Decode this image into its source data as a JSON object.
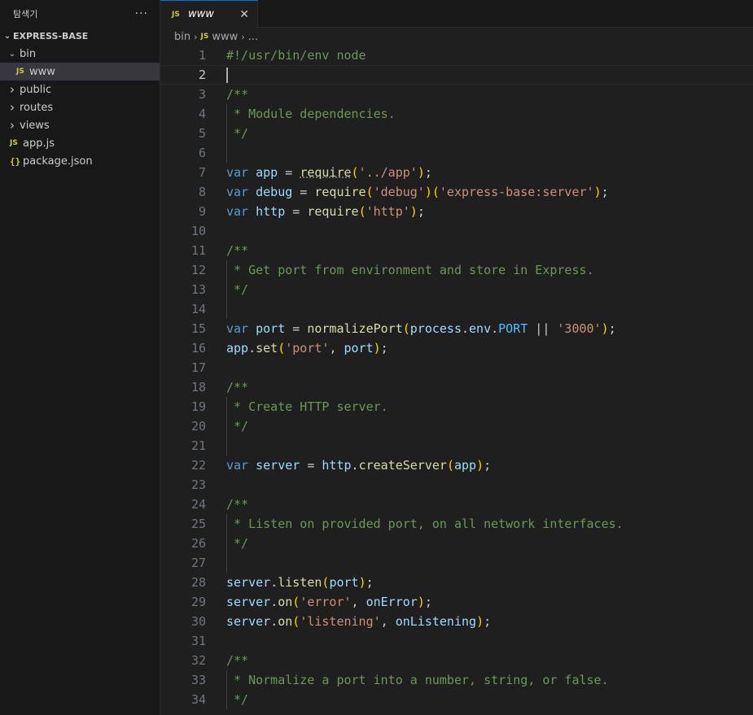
{
  "sidebar": {
    "title": "탐색기",
    "more": "···",
    "section": "EXPRESS-BASE",
    "items": [
      {
        "label": "bin",
        "type": "folder-open"
      },
      {
        "label": "www",
        "type": "js",
        "selected": true
      },
      {
        "label": "public",
        "type": "folder"
      },
      {
        "label": "routes",
        "type": "folder"
      },
      {
        "label": "views",
        "type": "folder"
      },
      {
        "label": "app.js",
        "type": "js"
      },
      {
        "label": "package.json",
        "type": "json"
      }
    ],
    "js_badge": "JS",
    "json_badge": "{}"
  },
  "tab": {
    "icon": "JS",
    "label": "www",
    "close": "✕"
  },
  "breadcrumb": {
    "parts": [
      "bin",
      "www",
      "..."
    ],
    "icon": "JS"
  },
  "editor": {
    "current_line": 2,
    "lines": [
      "#!/usr/bin/env node",
      "",
      "/**",
      " * Module dependencies.",
      " */",
      "",
      "var app = require('../app');",
      "var debug = require('debug')('express-base:server');",
      "var http = require('http');",
      "",
      "/**",
      " * Get port from environment and store in Express.",
      " */",
      "",
      "var port = normalizePort(process.env.PORT || '3000');",
      "app.set('port', port);",
      "",
      "/**",
      " * Create HTTP server.",
      " */",
      "",
      "var server = http.createServer(app);",
      "",
      "/**",
      " * Listen on provided port, on all network interfaces.",
      " */",
      "",
      "server.listen(port);",
      "server.on('error', onError);",
      "server.on('listening', onListening);",
      "",
      "/**",
      " * Normalize a port into a number, string, or false.",
      " */"
    ]
  },
  "colors": {
    "background": "#1f1f1f",
    "comment": "#6a9955",
    "keyword": "#569cd6",
    "variable": "#9cdcfe",
    "function": "#dcdcaa",
    "string": "#ce9178",
    "js_icon": "#cbcb41"
  }
}
